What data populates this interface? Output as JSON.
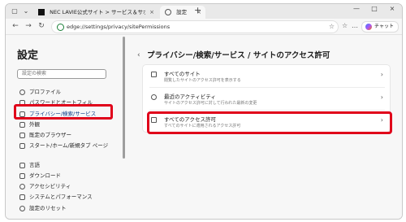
{
  "browser": {
    "tabs": [
      {
        "title": "NEC LAVIE公式サイト > サービス＆サポ",
        "close": "×"
      },
      {
        "title": "設定",
        "close": "×"
      }
    ],
    "new_tab": "+",
    "address": "edge://settings/privacy/sitePermissions",
    "chat_label": "チャット",
    "window_controls": [
      "—",
      "□",
      "×"
    ]
  },
  "sidebar": {
    "title": "設定",
    "search_placeholder": "設定の検索",
    "items": [
      {
        "label": "プロファイル",
        "icon": "profile-icon"
      },
      {
        "label": "パスワードとオートフィル",
        "icon": "key-icon"
      },
      {
        "label": "プライバシー/検索/サービス",
        "icon": "lock-icon",
        "selected": true
      },
      {
        "label": "外観",
        "icon": "appearance-icon"
      },
      {
        "label": "既定のブラウザー",
        "icon": "browser-icon"
      },
      {
        "label": "スタート/ホーム/新規タブ ページ",
        "icon": "home-icon"
      },
      {
        "label": "言語",
        "icon": "language-icon"
      },
      {
        "label": "ダウンロード",
        "icon": "download-icon"
      },
      {
        "label": "アクセシビリティ",
        "icon": "accessibility-icon"
      },
      {
        "label": "システムとパフォーマンス",
        "icon": "system-icon"
      },
      {
        "label": "設定のリセット",
        "icon": "reset-icon"
      }
    ]
  },
  "main": {
    "title": "プライバシー/検索/サービス / サイトのアクセス許可",
    "rows": [
      {
        "title": "すべてのサイト",
        "subtitle": "閲覧したサイトのアクセス許可を表示する"
      },
      {
        "title": "最近のアクティビティ",
        "subtitle": "サイトのアクセス許可に対して行われた最新の変更"
      },
      {
        "title": "すべてのアクセス許可",
        "subtitle": "すべてのサイトに適用されるアクセス許可"
      }
    ]
  },
  "colors": {
    "highlight": "#e0001a",
    "accent": "#0f6cbd"
  }
}
